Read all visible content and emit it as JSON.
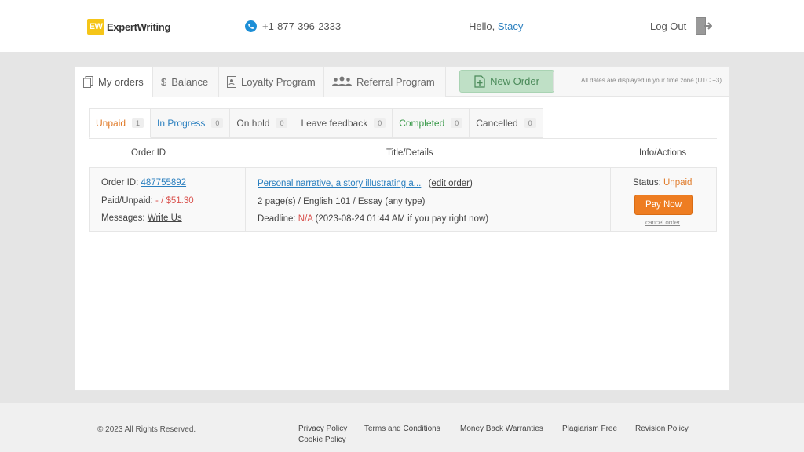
{
  "header": {
    "logo_badge": "EW",
    "logo_text": "ExpertWriting",
    "phone": "+1-877-396-2333",
    "hello_prefix": "Hello, ",
    "user_name": "Stacy",
    "logout_label": "Log Out"
  },
  "nav": {
    "my_orders": "My orders",
    "balance": "Balance",
    "loyalty": "Loyalty Program",
    "referral": "Referral Program",
    "new_order": "New Order",
    "tz_note": "All dates are displayed in your time zone (UTC +3)"
  },
  "tabs": [
    {
      "label": "Unpaid",
      "count": "1"
    },
    {
      "label": "In Progress",
      "count": "0"
    },
    {
      "label": "On hold",
      "count": "0"
    },
    {
      "label": "Leave feedback",
      "count": "0"
    },
    {
      "label": "Completed",
      "count": "0"
    },
    {
      "label": "Cancelled",
      "count": "0"
    }
  ],
  "table": {
    "headers": {
      "order_id": "Order ID",
      "title": "Title/Details",
      "info": "Info/Actions"
    },
    "rows": [
      {
        "order_id_label": "Order ID: ",
        "order_id": "487755892",
        "paid_label": "Paid/Unpaid: ",
        "paid_value": "- / $51.30",
        "messages_label": "Messages: ",
        "messages_link": "Write Us",
        "title": "Personal narrative, a story illustrating a...",
        "edit_open": "(",
        "edit_link": "edit order",
        "edit_close": ")",
        "details": "2 page(s) / English 101 / Essay (any type)",
        "deadline_label": "Deadline: ",
        "deadline_na": "N/A",
        "deadline_note": " (2023-08-24 01:44 AM if you pay right now)",
        "status_label": "Status: ",
        "status_value": "Unpaid",
        "pay_now": "Pay Now",
        "cancel_order": "cancel order"
      }
    ]
  },
  "footer": {
    "copyright": "© 2023 All Rights Reserved.",
    "links": {
      "privacy": "Privacy Policy",
      "cookie": "Cookie Policy",
      "terms": "Terms and Conditions",
      "money_back": "Money Back Warranties",
      "plagiarism": "Plagiarism Free",
      "revision": "Revision Policy"
    }
  },
  "colors": {
    "accent_orange": "#ee7d22",
    "link_blue": "#2a7fbf",
    "new_order_green": "#bfe0c6",
    "logo_yellow": "#f5c518"
  },
  "icons": [
    "phone-icon",
    "logout-icon",
    "orders-icon",
    "dollar-icon",
    "loyalty-icon",
    "referral-icon",
    "new-order-icon"
  ]
}
